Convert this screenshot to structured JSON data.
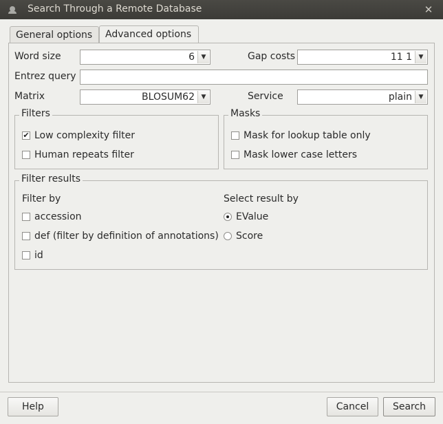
{
  "window": {
    "title": "Search Through a Remote Database",
    "close_glyph": "✕"
  },
  "tabs": [
    {
      "label": "General options",
      "active": false
    },
    {
      "label": "Advanced options",
      "active": true
    }
  ],
  "advanced": {
    "word_size": {
      "label": "Word size",
      "value": "6"
    },
    "gap_costs": {
      "label": "Gap costs",
      "value": "11 1"
    },
    "entrez_query": {
      "label": "Entrez query",
      "value": ""
    },
    "matrix": {
      "label": "Matrix",
      "value": "BLOSUM62"
    },
    "service": {
      "label": "Service",
      "value": "plain"
    }
  },
  "filters": {
    "title": "Filters",
    "items": [
      {
        "label": "Low complexity filter",
        "checked": true
      },
      {
        "label": "Human repeats filter",
        "checked": false
      }
    ]
  },
  "masks": {
    "title": "Masks",
    "items": [
      {
        "label": "Mask for lookup table only",
        "checked": false
      },
      {
        "label": "Mask lower case letters",
        "checked": false
      }
    ]
  },
  "filter_results": {
    "title": "Filter results",
    "filter_by": {
      "label": "Filter by",
      "items": [
        {
          "label": "accession",
          "checked": false
        },
        {
          "label": "def (filter by definition of annotations)",
          "checked": false
        },
        {
          "label": "id",
          "checked": false
        }
      ]
    },
    "select_by": {
      "label": "Select result by",
      "items": [
        {
          "label": "EValue",
          "selected": true
        },
        {
          "label": "Score",
          "selected": false
        }
      ]
    }
  },
  "buttons": {
    "help": "Help",
    "cancel": "Cancel",
    "search": "Search"
  },
  "icons": {
    "combo_arrow": "▼",
    "check": "✔"
  }
}
